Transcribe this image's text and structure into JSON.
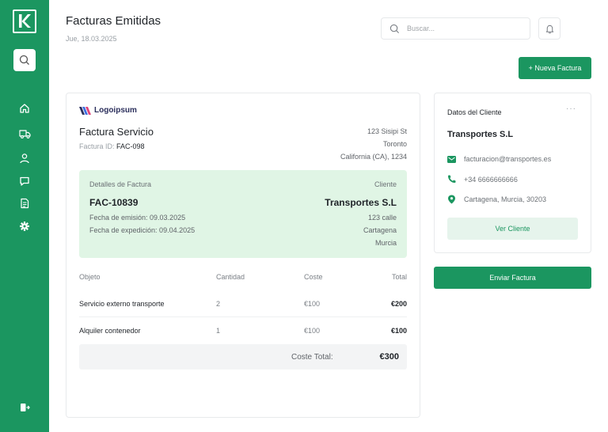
{
  "app": {
    "logo_letter": "K"
  },
  "sidebar": {
    "items": [
      {
        "name": "home-icon"
      },
      {
        "name": "truck-icon"
      },
      {
        "name": "user-icon"
      },
      {
        "name": "chat-icon"
      },
      {
        "name": "invoice-icon"
      },
      {
        "name": "gear-icon"
      }
    ],
    "bottom": {
      "name": "logout-icon"
    }
  },
  "header": {
    "title": "Facturas Emitidas",
    "date": "Jue, 18.03.2025",
    "search_placeholder": "Buscar...",
    "new_invoice_label": "+ Nueva Factura"
  },
  "invoice": {
    "brand": "Logoipsum",
    "title": "Factura Servicio",
    "id_label": "Factura ID:",
    "id_value": "FAC-098",
    "address": [
      "123 Sisipi St",
      "Toronto",
      "California (CA), 1234"
    ],
    "details": {
      "label_left": "Detalles de Factura",
      "label_right": "Cliente",
      "code": "FAC-10839",
      "issue_date": "Fecha de emisión: 09.03.2025",
      "expedition_date": "Fecha de expedición: 09.04.2025",
      "client_name": "Transportes S.L",
      "client_address": [
        "123 calle",
        "Cartagena",
        "Murcia"
      ]
    },
    "table": {
      "headers": [
        "Objeto",
        "Cantidad",
        "Coste",
        "Total"
      ],
      "rows": [
        [
          "Servicio externo transporte",
          "2",
          "€100",
          "€200"
        ],
        [
          "Alquiler contenedor",
          "1",
          "€100",
          "€100"
        ]
      ]
    },
    "total_label": "Coste Total:",
    "total_value": "€300"
  },
  "client": {
    "header": "Datos del Cliente",
    "more": "···",
    "name": "Transportes S.L",
    "email": "facturacion@transportes.es",
    "phone": "+34 6666666666",
    "location": "Cartagena, Murcia, 30203",
    "view_label": "Ver Cliente"
  },
  "send_label": "Enviar Factura",
  "colors": {
    "primary": "#1b9660",
    "details_bg": "#e0f5e5",
    "view_btn_bg": "#e6f4ec"
  }
}
